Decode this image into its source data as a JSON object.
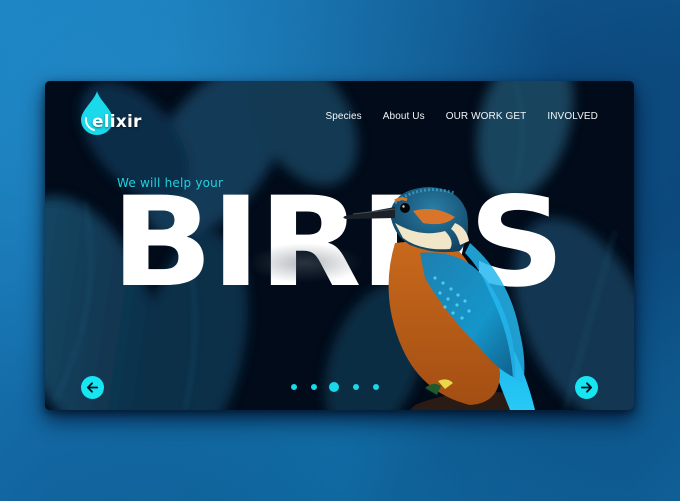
{
  "brand": {
    "name": "elixir",
    "logo_icon": "water-drop-icon",
    "accent_color": "#17e6f2"
  },
  "nav": {
    "items": [
      {
        "label": "Species"
      },
      {
        "label": "About Us"
      },
      {
        "label": "OUR WORK GET"
      },
      {
        "label": "INVOLVED"
      }
    ]
  },
  "hero": {
    "tagline": "We will help your",
    "headline": "BIRDS",
    "image_subject": "kingfisher-bird"
  },
  "carousel": {
    "prev_icon": "arrow-left-icon",
    "next_icon": "arrow-right-icon",
    "slide_count": 5,
    "active_slide": 3
  },
  "colors": {
    "background": "#1570ad",
    "card": "#020a18",
    "accent": "#17e6f2",
    "tagline": "#1fd1df",
    "headline": "#ffffff"
  }
}
